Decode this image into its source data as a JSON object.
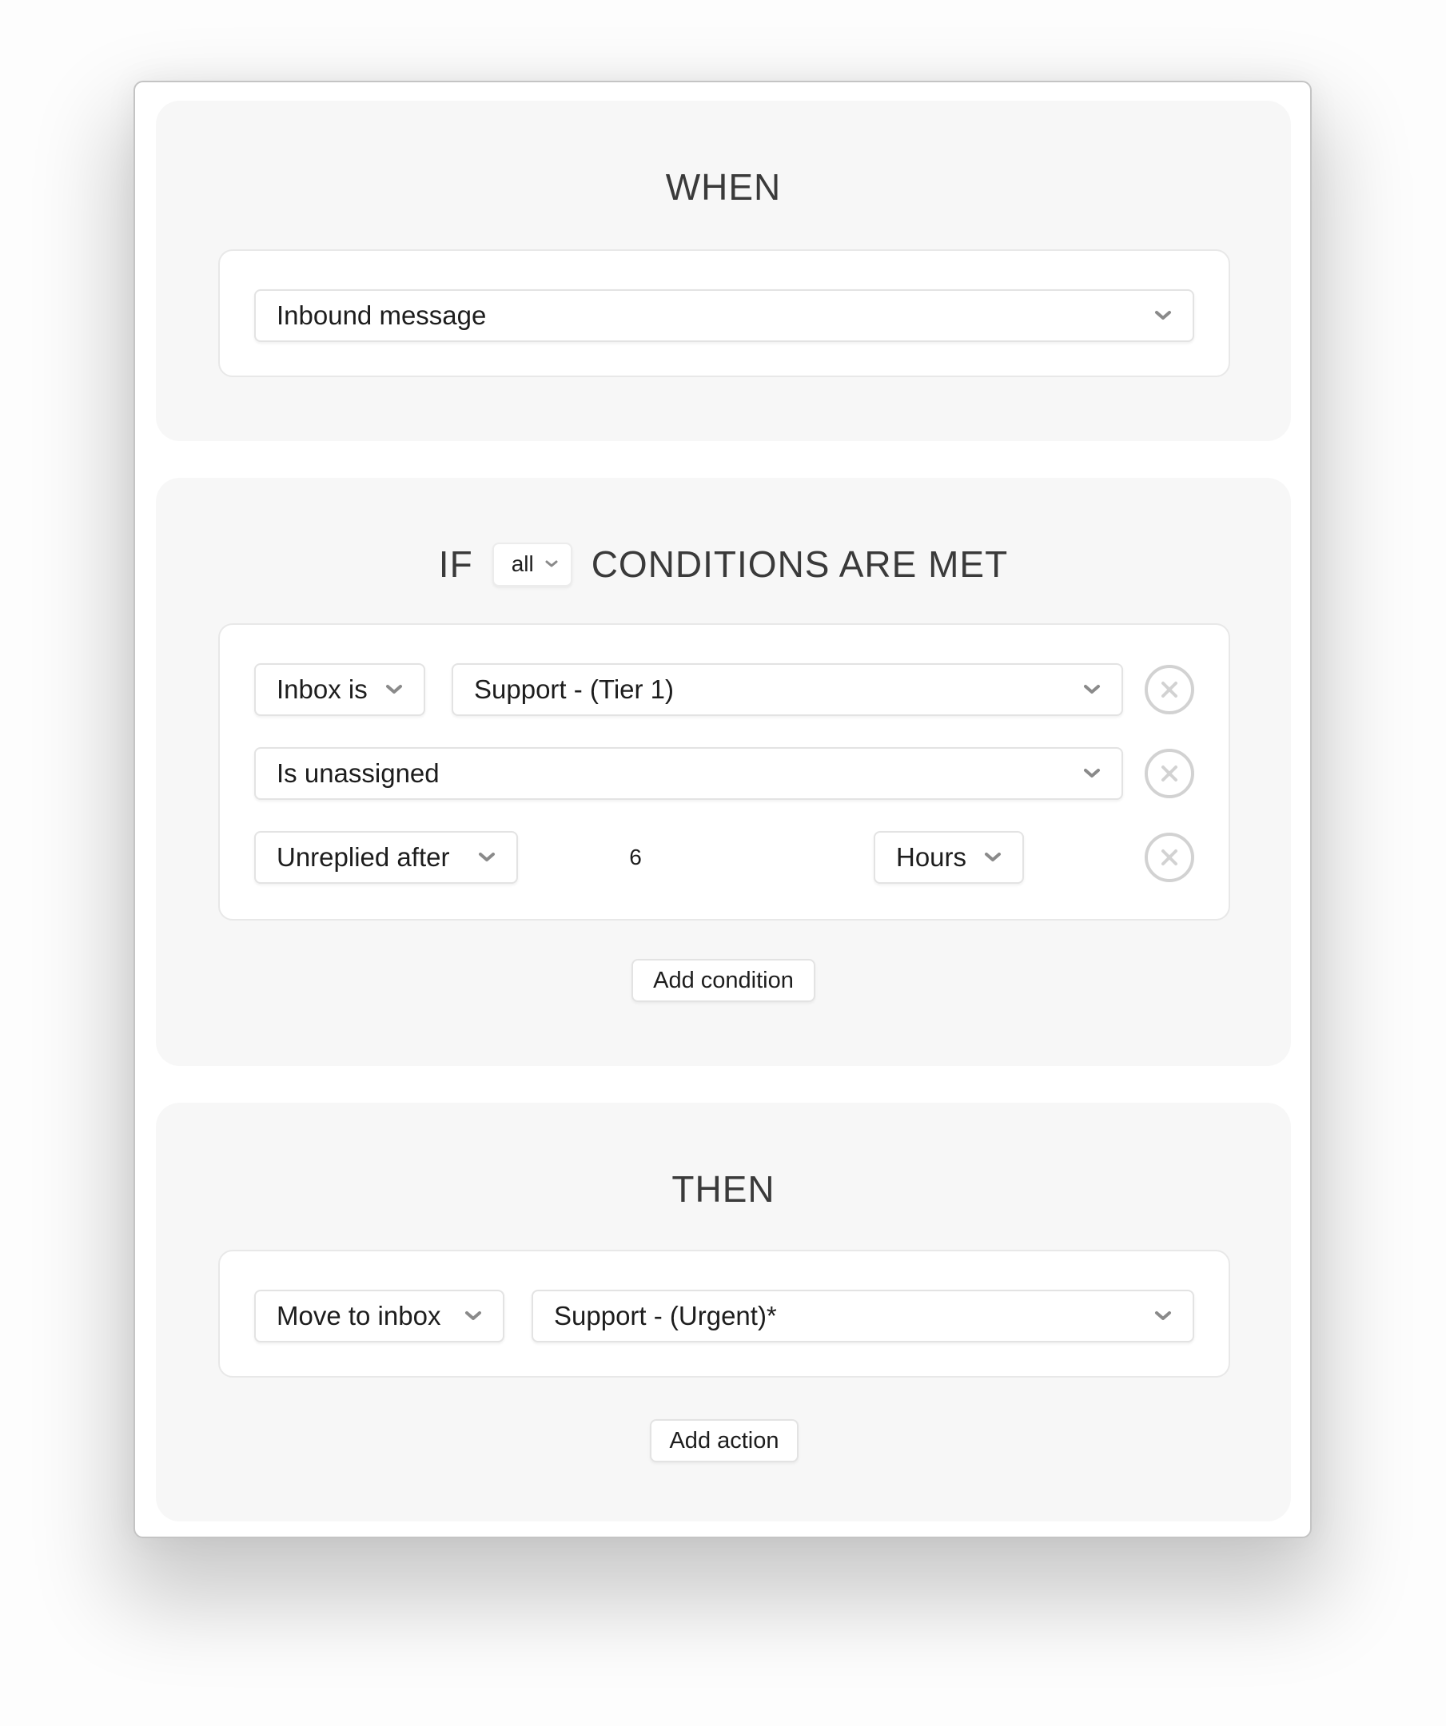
{
  "when": {
    "title": "WHEN",
    "trigger": {
      "value": "Inbound message",
      "icon": "chevron-down-icon"
    }
  },
  "if": {
    "title_prefix": "IF",
    "match_mode": "all",
    "title_suffix": "CONDITIONS ARE MET",
    "conditions": [
      {
        "field": "Inbox is",
        "value": "Support - (Tier 1)"
      },
      {
        "field": "Is unassigned"
      },
      {
        "field": "Unreplied after",
        "amount": "6",
        "unit": "Hours"
      }
    ],
    "remove_icon": "close-circle-icon",
    "add_condition_label": "Add condition"
  },
  "then": {
    "title": "THEN",
    "actions": [
      {
        "action": "Move to inbox",
        "target": "Support - (Urgent)*"
      }
    ],
    "add_action_label": "Add action"
  },
  "colors": {
    "section_bg": "#f7f7f7",
    "card_bg": "#ffffff",
    "chevron": "#8a8a8a",
    "remove_icon": "#d2d2d2",
    "title_text": "#3a3a3a"
  }
}
